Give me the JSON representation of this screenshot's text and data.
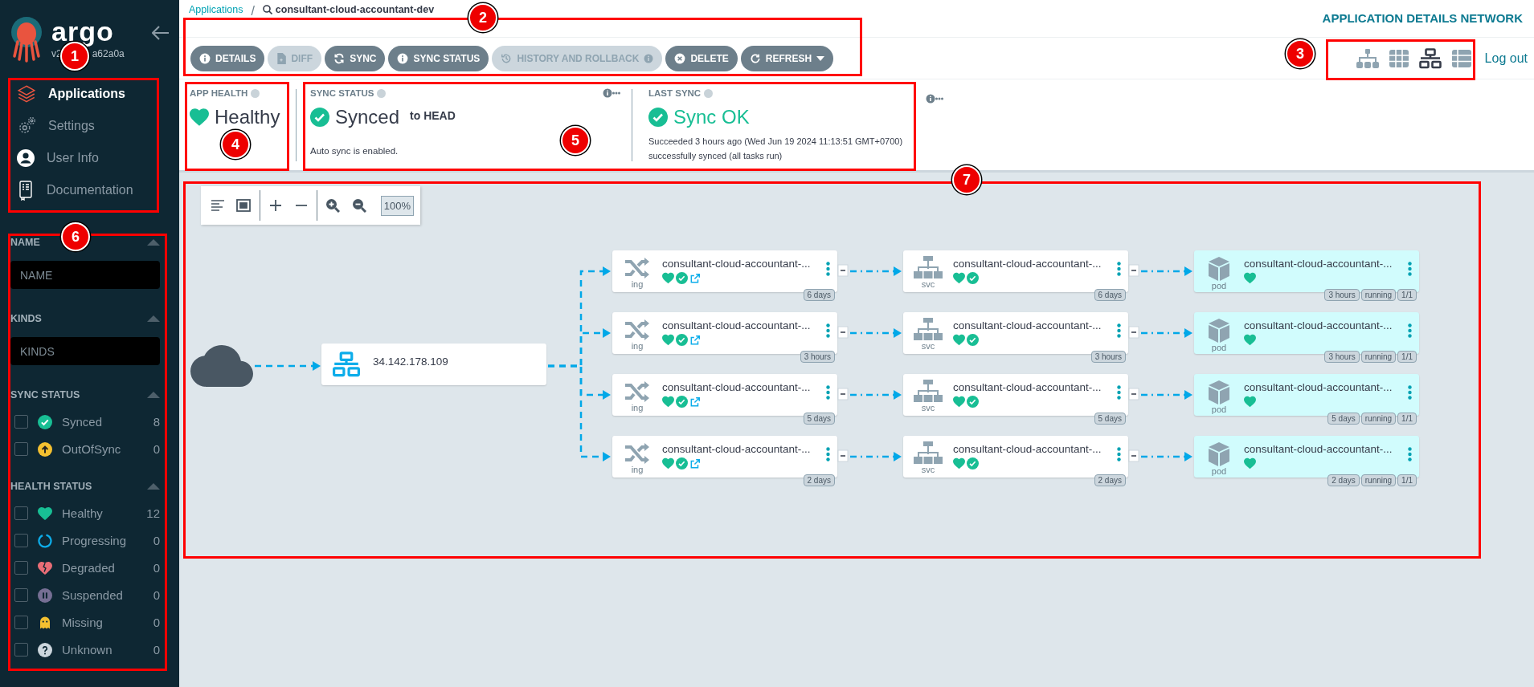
{
  "sidebar": {
    "logo": "argo",
    "version_parts": [
      "v2",
      "a62a0a"
    ],
    "nav": [
      {
        "label": "Applications",
        "selected": true,
        "kind": "layers"
      },
      {
        "label": "Settings",
        "selected": false,
        "kind": "gears"
      },
      {
        "label": "User Info",
        "selected": false,
        "kind": "user"
      },
      {
        "label": "Documentation",
        "selected": false,
        "kind": "book"
      }
    ],
    "filters": [
      {
        "kind": "input",
        "title": "NAME",
        "placeholder": "NAME"
      },
      {
        "kind": "input",
        "title": "KINDS",
        "placeholder": "KINDS"
      },
      {
        "kind": "checklist",
        "title": "SYNC STATUS",
        "options": [
          {
            "label": "Synced",
            "count": "8",
            "checked": false,
            "kind": "synced"
          },
          {
            "label": "OutOfSync",
            "count": "0",
            "checked": false,
            "kind": "outofsync"
          }
        ]
      },
      {
        "kind": "checklist",
        "title": "HEALTH STATUS",
        "options": [
          {
            "label": "Healthy",
            "count": "12",
            "checked": false,
            "kind": "healthy"
          },
          {
            "label": "Progressing",
            "count": "0",
            "checked": false,
            "kind": "progressing"
          },
          {
            "label": "Degraded",
            "count": "0",
            "checked": false,
            "kind": "degraded"
          },
          {
            "label": "Suspended",
            "count": "0",
            "checked": false,
            "kind": "suspended"
          },
          {
            "label": "Missing",
            "count": "0",
            "checked": false,
            "kind": "missing"
          },
          {
            "label": "Unknown",
            "count": "0",
            "checked": false,
            "kind": "unknown"
          }
        ]
      }
    ]
  },
  "header": {
    "breadcrumb": {
      "link": "Applications",
      "separator": "/",
      "current": "consultant-cloud-accountant-dev"
    },
    "title": "APPLICATION DETAILS NETWORK"
  },
  "actions": [
    {
      "label": "DETAILS",
      "kind": "details",
      "disabled": false
    },
    {
      "label": "DIFF",
      "kind": "diff",
      "disabled": true
    },
    {
      "label": "SYNC",
      "kind": "sync",
      "disabled": false
    },
    {
      "label": "SYNC STATUS",
      "kind": "sync_status",
      "disabled": false
    },
    {
      "label": "HISTORY AND ROLLBACK",
      "kind": "history",
      "disabled": true
    },
    {
      "label": "DELETE",
      "kind": "delete",
      "disabled": false
    },
    {
      "label": "REFRESH",
      "kind": "refresh",
      "disabled": false
    }
  ],
  "views": [
    {
      "kind": "tree",
      "selected": false
    },
    {
      "kind": "pods",
      "selected": false
    },
    {
      "kind": "network",
      "selected": true
    },
    {
      "kind": "list",
      "selected": false
    }
  ],
  "logout": "Log out",
  "summary": {
    "app_health": {
      "title": "APP HEALTH",
      "status": "Healthy"
    },
    "sync_status": {
      "title": "SYNC STATUS",
      "status": "Synced",
      "revision": "to HEAD",
      "note": "Auto sync is enabled."
    },
    "last_sync": {
      "title": "LAST SYNC",
      "status": "Sync OK",
      "lines": [
        "Succeeded 3 hours ago (Wed Jun 19 2024 11:13:51 GMT+0700)",
        "successfully synced (all tasks run)"
      ]
    }
  },
  "graph": {
    "zoom_level": "100%",
    "load_balancer": "34.142.178.109",
    "rows": [
      [
        {
          "kind": "ing",
          "name": "consultant-cloud-accountant-...",
          "tags": [
            "6 days"
          ]
        },
        {
          "kind": "svc",
          "name": "consultant-cloud-accountant-...",
          "tags": [
            "6 days"
          ]
        },
        {
          "kind": "pod",
          "name": "consultant-cloud-accountant-...",
          "tags": [
            "3 hours",
            "running",
            "1/1"
          ]
        }
      ],
      [
        {
          "kind": "ing",
          "name": "consultant-cloud-accountant-...",
          "tags": [
            "3 hours"
          ]
        },
        {
          "kind": "svc",
          "name": "consultant-cloud-accountant-...",
          "tags": [
            "3 hours"
          ]
        },
        {
          "kind": "pod",
          "name": "consultant-cloud-accountant-...",
          "tags": [
            "3 hours",
            "running",
            "1/1"
          ]
        }
      ],
      [
        {
          "kind": "ing",
          "name": "consultant-cloud-accountant-...",
          "tags": [
            "5 days"
          ]
        },
        {
          "kind": "svc",
          "name": "consultant-cloud-accountant-...",
          "tags": [
            "5 days"
          ]
        },
        {
          "kind": "pod",
          "name": "consultant-cloud-accountant-...",
          "tags": [
            "5 days",
            "running",
            "1/1"
          ]
        }
      ],
      [
        {
          "kind": "ing",
          "name": "consultant-cloud-accountant-...",
          "tags": [
            "2 days"
          ]
        },
        {
          "kind": "svc",
          "name": "consultant-cloud-accountant-...",
          "tags": [
            "2 days"
          ]
        },
        {
          "kind": "pod",
          "name": "consultant-cloud-accountant-...",
          "tags": [
            "2 days",
            "running",
            "1/1"
          ]
        }
      ]
    ]
  },
  "annotations": [
    "1",
    "2",
    "3",
    "4",
    "5",
    "6",
    "7"
  ]
}
